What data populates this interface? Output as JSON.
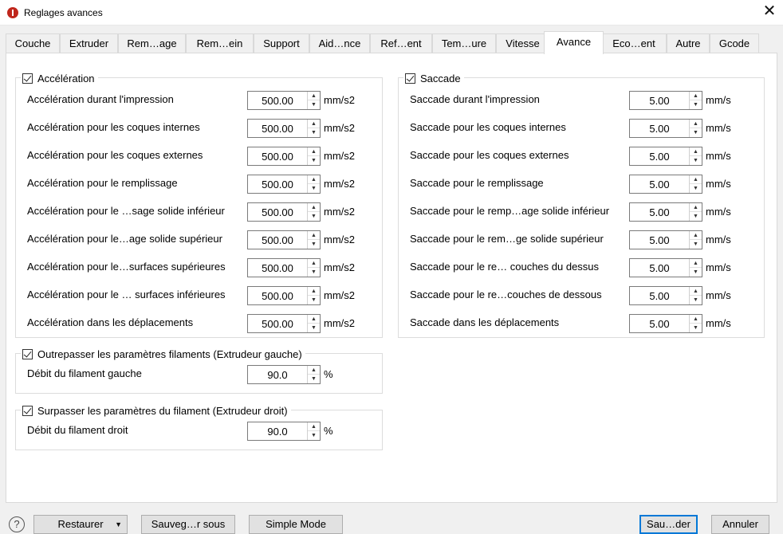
{
  "window": {
    "title": "Reglages avances",
    "close_symbol": "✕"
  },
  "tabs": [
    {
      "label": "Couche",
      "active": false
    },
    {
      "label": "Extruder",
      "active": false
    },
    {
      "label": "Rem…age",
      "active": false
    },
    {
      "label": "Rem…ein",
      "active": false
    },
    {
      "label": "Support",
      "active": false
    },
    {
      "label": "Aid…nce",
      "active": false
    },
    {
      "label": "Ref…ent",
      "active": false
    },
    {
      "label": "Tem…ure",
      "active": false
    },
    {
      "label": "Vitesse",
      "active": false
    },
    {
      "label": "Avance",
      "active": true
    },
    {
      "label": "Eco…ent",
      "active": false
    },
    {
      "label": "Autre",
      "active": false
    },
    {
      "label": "Gcode",
      "active": false
    }
  ],
  "acceleration": {
    "title": "Accélération",
    "checked": true,
    "unit": "mm/s2",
    "rows": [
      {
        "label": "Accélération durant l'impression",
        "value": "500.00"
      },
      {
        "label": "Accélération pour les coques internes",
        "value": "500.00"
      },
      {
        "label": "Accélération pour les coques externes",
        "value": "500.00"
      },
      {
        "label": "Accélération pour le remplissage",
        "value": "500.00"
      },
      {
        "label": "Accélération pour le …sage solide inférieur",
        "value": "500.00"
      },
      {
        "label": "Accélération pour le…age solide supérieur",
        "value": "500.00"
      },
      {
        "label": "Accélération pour le…surfaces supérieures",
        "value": "500.00"
      },
      {
        "label": "Accélération pour le … surfaces inférieures",
        "value": "500.00"
      },
      {
        "label": "Accélération dans les déplacements",
        "value": "500.00"
      }
    ]
  },
  "jerk": {
    "title": "Saccade",
    "checked": true,
    "unit": "mm/s",
    "rows": [
      {
        "label": "Saccade durant l'impression",
        "value": "5.00"
      },
      {
        "label": "Saccade pour les coques internes",
        "value": "5.00"
      },
      {
        "label": "Saccade pour les coques externes",
        "value": "5.00"
      },
      {
        "label": "Saccade pour le remplissage",
        "value": "5.00"
      },
      {
        "label": "Saccade pour le remp…age solide inférieur",
        "value": "5.00"
      },
      {
        "label": "Saccade pour le rem…ge solide supérieur",
        "value": "5.00"
      },
      {
        "label": "Saccade pour le re… couches du dessus",
        "value": "5.00"
      },
      {
        "label": "Saccade pour le re…couches de dessous",
        "value": "5.00"
      },
      {
        "label": "Saccade dans les déplacements",
        "value": "5.00"
      }
    ]
  },
  "override_left": {
    "title": "Outrepasser les paramètres filaments (Extrudeur gauche)",
    "checked": true,
    "row": {
      "label": "Débit du filament gauche",
      "value": "90.0",
      "unit": "%"
    }
  },
  "override_right": {
    "title": "Surpasser les paramètres du filament (Extrudeur droit)",
    "checked": true,
    "row": {
      "label": "Débit du filament droit",
      "value": "90.0",
      "unit": "%"
    }
  },
  "footer": {
    "help_symbol": "?",
    "restore": "Restaurer",
    "dropdown_symbol": "▼",
    "save_as": "Sauveg…r sous",
    "simple_mode": "Simple Mode",
    "save": "Sau…der",
    "cancel": "Annuler"
  },
  "spin_symbols": {
    "up": "▲",
    "down": "▼"
  }
}
